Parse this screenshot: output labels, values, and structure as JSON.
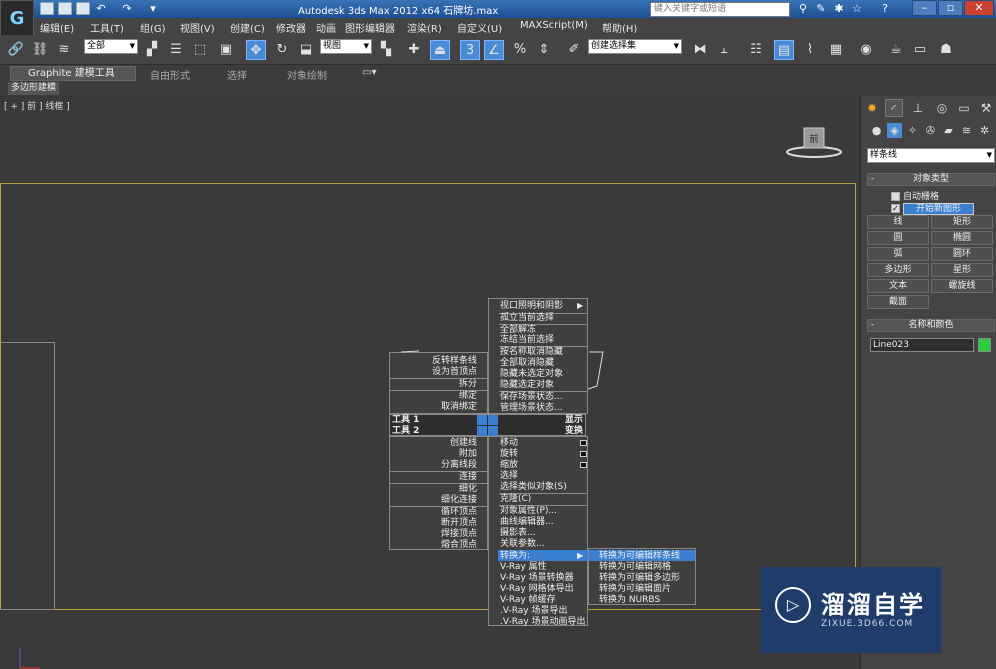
{
  "app": {
    "logo_glyph": "G",
    "title": "Autodesk 3ds Max  2012 x64       石牌坊.max",
    "search_placeholder": "键入关键字或短语"
  },
  "menubar": [
    "编辑(E)",
    "工具(T)",
    "组(G)",
    "视图(V)",
    "创建(C)",
    "修改器",
    "动画",
    "图形编辑器",
    "渲染(R)",
    "自定义(U)",
    "MAXScript(M)",
    "帮助(H)"
  ],
  "toolbar": {
    "selection_filter": "全部",
    "ref_coord": "视图",
    "named_selection": "创建选择集"
  },
  "ribbon": {
    "tabs": [
      "Graphite 建模工具",
      "自由形式",
      "选择",
      "对象绘制"
    ],
    "sub_tab": "多边形建模"
  },
  "viewport": {
    "label": "[ + ] 前 ] 线框 ]",
    "viewcube_label": "前"
  },
  "quad_menu": {
    "top_right": [
      "视口照明和阴影",
      "孤立当前选择",
      "全部解冻",
      "冻结当前选择",
      "按名称取消隐藏",
      "全部取消隐藏",
      "隐藏未选定对象",
      "隐藏选定对象",
      "保存场景状态...",
      "管理场景状态..."
    ],
    "top_left": [
      "反转样条线",
      "设为首顶点",
      "拆分",
      "绑定",
      "取消绑定"
    ],
    "tool1_left": "工具 1",
    "tool1_right": "显示",
    "tool2_left": "工具 2",
    "tool2_right": "变换",
    "bottom_left": [
      "创建线",
      "附加",
      "分离线段",
      "连接",
      "细化",
      "细化连接",
      "循环顶点",
      "断开顶点",
      "焊接顶点",
      "熔合顶点"
    ],
    "bottom_right": [
      "移动",
      "旋转",
      "缩放",
      "选择",
      "选择类似对象(S)",
      "克隆(C)",
      "对象属性(P)...",
      "曲线编辑器...",
      "摄影表...",
      "关联参数...",
      "转换为:",
      "V-Ray 属性",
      "V-Ray 场景转换器",
      "V-Ray 网格体导出",
      "V-Ray 帧缓存",
      ".V-Ray 场景导出",
      ".V-Ray 场景动画导出"
    ],
    "submenu": [
      "转换为可编辑样条线",
      "转换为可编辑网格",
      "转换为可编辑多边形",
      "转换为可编辑面片",
      "转换为 NURBS"
    ]
  },
  "command_panel": {
    "category": "样条线",
    "object_type_title": "对象类型",
    "auto_grid": "自动栅格",
    "start_new_shape": "开始新图形",
    "buttons": [
      "线",
      "矩形",
      "圆",
      "椭圆",
      "弧",
      "圆环",
      "多边形",
      "星形",
      "文本",
      "螺旋线",
      "截面"
    ],
    "name_color_title": "名称和颜色",
    "object_name": "Line023"
  },
  "watermark": {
    "title": "溜溜自学",
    "url": "ZIXUE.3D66.COM"
  }
}
